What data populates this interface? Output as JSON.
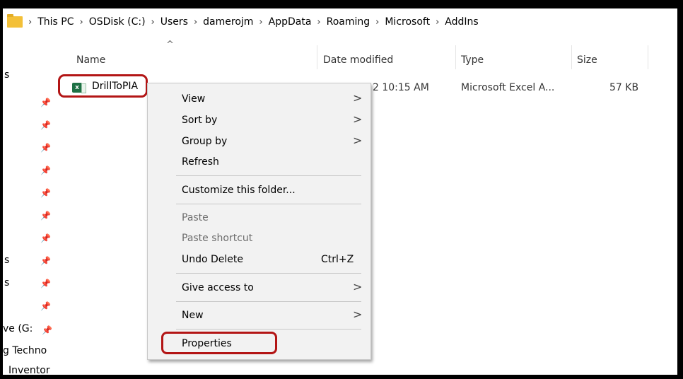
{
  "breadcrumb": {
    "items": [
      "This PC",
      "OSDisk (C:)",
      "Users",
      "damerojm",
      "AppData",
      "Roaming",
      "Microsoft",
      "AddIns"
    ],
    "separator": "›"
  },
  "columns": {
    "name": "Name",
    "sort_glyph": "^",
    "date": "Date modified",
    "type": "Type",
    "size": "Size"
  },
  "nav": {
    "pin_glyph": "📌",
    "partial_labels": [
      "s",
      "s",
      "s",
      "ve (G:",
      "g Techno",
      "Inventor"
    ]
  },
  "file": {
    "name": "DrillToPIA",
    "date_modified": "2 10:15 AM",
    "type": "Microsoft Excel A...",
    "size": "57 KB",
    "icon": "excel-addin-icon",
    "icon_glyph": "x"
  },
  "context_menu": {
    "view": "View",
    "sort_by": "Sort by",
    "group_by": "Group by",
    "refresh": "Refresh",
    "customize": "Customize this folder...",
    "paste": "Paste",
    "paste_shortcut": "Paste shortcut",
    "undo_delete": "Undo Delete",
    "undo_shortcut": "Ctrl+Z",
    "give_access": "Give access to",
    "new": "New",
    "properties": "Properties",
    "submenu_arrow": ">"
  },
  "colors": {
    "highlight_border": "#b31515",
    "menu_bg": "#f2f2f2",
    "excel_green": "#1e7145"
  }
}
